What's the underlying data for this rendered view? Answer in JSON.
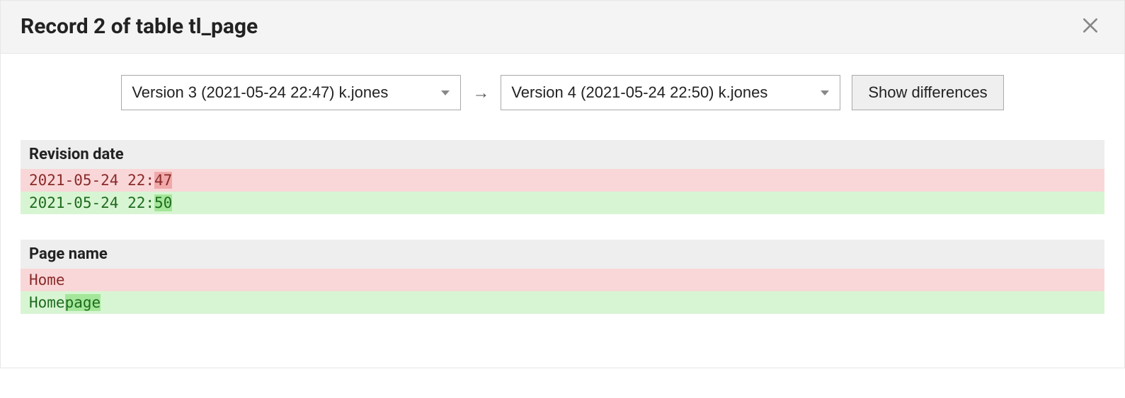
{
  "header": {
    "title": "Record 2 of table tl_page"
  },
  "controls": {
    "from_version": "Version 3 (2021-05-24 22:47) k.jones",
    "to_version": "Version 4 (2021-05-24 22:50) k.jones",
    "arrow": "→",
    "show_diff_label": "Show differences"
  },
  "diffs": [
    {
      "label": "Revision date",
      "old_prefix": "2021-05-24 22:",
      "old_highlight": "47",
      "old_suffix": "",
      "new_prefix": "2021-05-24 22:",
      "new_highlight": "50",
      "new_suffix": ""
    },
    {
      "label": "Page name",
      "old_prefix": "Home",
      "old_highlight": "",
      "old_suffix": "",
      "new_prefix": "Home",
      "new_highlight": "page",
      "new_suffix": ""
    }
  ]
}
